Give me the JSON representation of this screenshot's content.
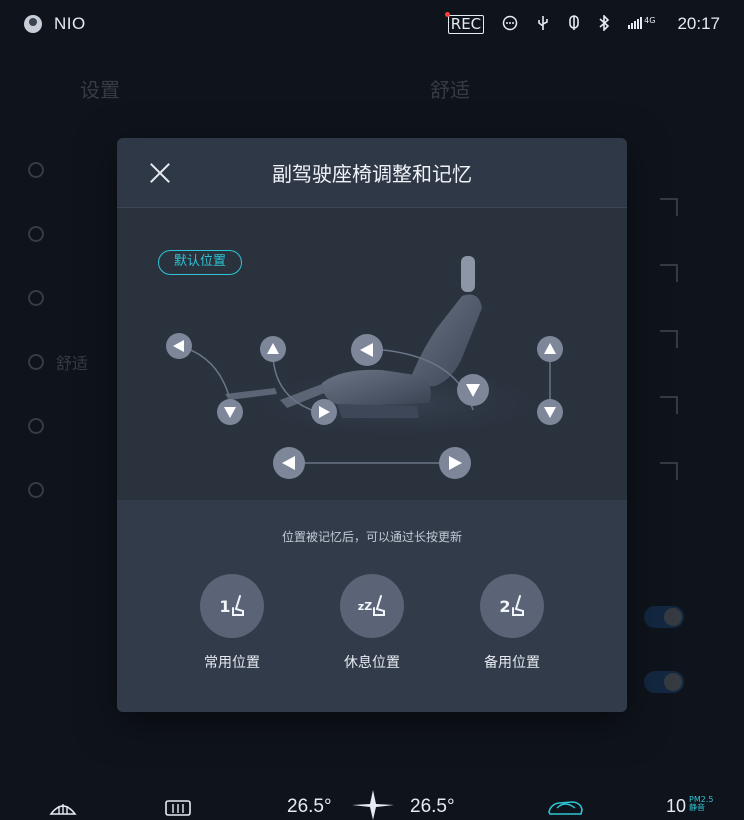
{
  "status_bar": {
    "brand": "NIO",
    "rec_label": "REC",
    "signal": "4G",
    "time": "20:17",
    "icons": [
      "rec-camera-icon",
      "message-icon",
      "usb-icon",
      "location-icon",
      "bluetooth-icon",
      "signal-icon"
    ]
  },
  "background": {
    "left_title": "设置",
    "right_title": "舒适",
    "sidebar_items": [
      "舒适"
    ]
  },
  "modal": {
    "title": "副驾驶座椅调整和记忆",
    "default_position_label": "默认位置",
    "memory_hint": "位置被记忆后，可以通过长按更新",
    "memory_positions": [
      {
        "icon_text": "1",
        "label": "常用位置"
      },
      {
        "icon_text": "zZ",
        "label": "休息位置"
      },
      {
        "icon_text": "2",
        "label": "备用位置"
      }
    ]
  },
  "climate_bar": {
    "left_temp": "26.5°",
    "right_temp": "26.5°",
    "pm_value": "10",
    "pm_label": "PM2.5",
    "pm_status": "静音"
  },
  "colors": {
    "accent": "#2ec4d3",
    "modal_bg": "#2b3340",
    "memory_bg": "#323b4a",
    "button_bg": "#5a6476"
  }
}
